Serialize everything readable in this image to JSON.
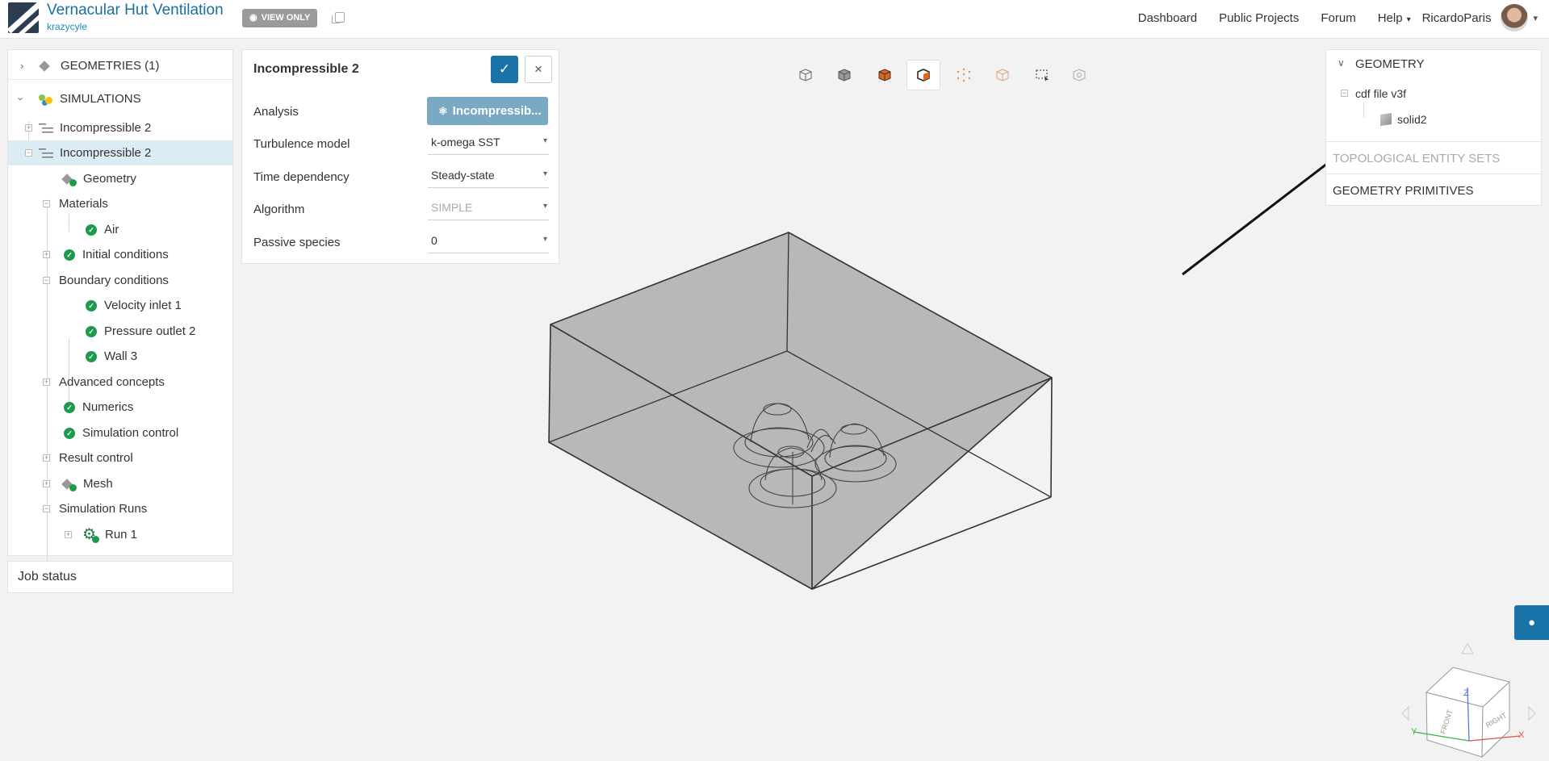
{
  "header": {
    "project_title": "Vernacular Hut Ventilation",
    "owner": "krazycyle",
    "view_only_label": "VIEW ONLY",
    "nav": [
      "Dashboard",
      "Public Projects",
      "Forum",
      "Help"
    ],
    "username": "RicardoParis"
  },
  "tree": {
    "geometries_label": "GEOMETRIES (1)",
    "simulations_label": "SIMULATIONS",
    "sim1": "Incompressible 2",
    "sim2": "Incompressible 2",
    "geometry": "Geometry",
    "materials": "Materials",
    "air": "Air",
    "initial_conditions": "Initial conditions",
    "boundary_conditions": "Boundary conditions",
    "velocity_inlet": "Velocity inlet 1",
    "pressure_outlet": "Pressure outlet 2",
    "wall": "Wall 3",
    "advanced_concepts": "Advanced concepts",
    "numerics": "Numerics",
    "simulation_control": "Simulation control",
    "result_control": "Result control",
    "mesh": "Mesh",
    "simulation_runs": "Simulation Runs",
    "run1": "Run 1"
  },
  "job_status": "Job status",
  "settings": {
    "title": "Incompressible 2",
    "analysis_label": "Analysis",
    "analysis_value": "Incompressib...",
    "turbulence_label": "Turbulence model",
    "turbulence_value": "k-omega SST",
    "time_label": "Time dependency",
    "time_value": "Steady-state",
    "algorithm_label": "Algorithm",
    "algorithm_value": "SIMPLE",
    "passive_label": "Passive species",
    "passive_value": "0"
  },
  "right_panel": {
    "geometry_header": "GEOMETRY",
    "file_name": "cdf file v3f",
    "solid_name": "solid2",
    "topological_sets": "TOPOLOGICAL ENTITY SETS",
    "geometry_primitives": "GEOMETRY PRIMITIVES"
  },
  "orientation_cube": {
    "top_label": "Z",
    "front_label": "FRONT",
    "right_label": "RIGHT",
    "x_label": "X",
    "y_label": "Y"
  },
  "colors": {
    "brand_blue": "#1a73a8",
    "selected_row": "#dcecf5",
    "ok_green": "#1d9a4b",
    "model_fill": "#b9b9b9"
  }
}
